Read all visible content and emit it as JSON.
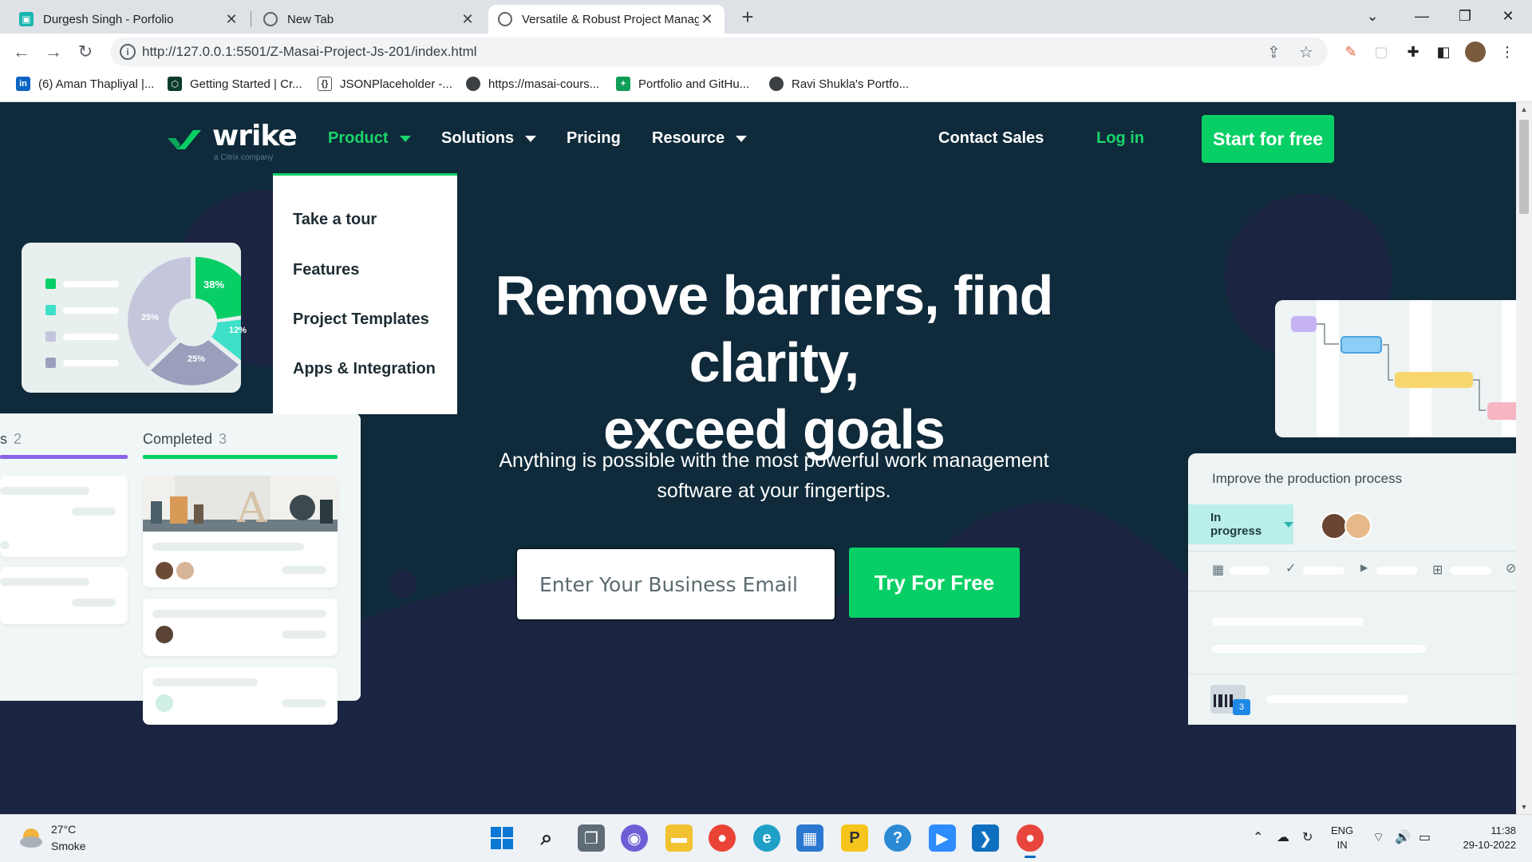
{
  "browser": {
    "tabs": [
      {
        "title": "Durgesh Singh - Porfolio",
        "icon": "portfolio-favicon"
      },
      {
        "title": "New Tab",
        "icon": "chrome-favicon"
      },
      {
        "title": "Versatile & Robust Project Manag",
        "icon": "globe-favicon"
      }
    ],
    "url": "http://127.0.0.1:5501/Z-Masai-Project-Js-201/index.html",
    "bookmarks": [
      {
        "label": "(6) Aman Thapliyal |...",
        "icon": "linkedin-icon"
      },
      {
        "label": "Getting Started | Cr...",
        "icon": "crypto-icon"
      },
      {
        "label": "JSONPlaceholder -...",
        "icon": "json-icon"
      },
      {
        "label": "https://masai-cours...",
        "icon": "globe-icon"
      },
      {
        "label": "Portfolio and GitHu...",
        "icon": "sheets-icon"
      },
      {
        "label": "Ravi Shukla's Portfo...",
        "icon": "globe-icon"
      }
    ]
  },
  "site": {
    "logo": {
      "word": "wrike",
      "sub": "a Citrix company"
    },
    "nav": {
      "product": "Product",
      "solutions": "Solutions",
      "pricing": "Pricing",
      "resource": "Resource",
      "contact": "Contact Sales",
      "login": "Log in",
      "start": "Start for free"
    },
    "dropdown": [
      "Take a tour",
      "Features",
      "Project Templates",
      "Apps & Integration"
    ],
    "hero": {
      "title_line1": "Remove barriers, find clarity,",
      "title_line2": "exceed goals",
      "subtitle_line1": "Anything is possible with the most powerful work management",
      "subtitle_line2": "software at your fingertips.",
      "email_placeholder": "Enter Your Business Email",
      "cta": "Try For Free"
    },
    "donut": {
      "labels": [
        "38%",
        "12%",
        "25%",
        "25%"
      ]
    },
    "kanban": {
      "col1_title": "s",
      "col1_count": "2",
      "col2_title": "Completed",
      "col2_count": "3"
    },
    "task": {
      "title": "Improve the production process",
      "status": "In progress",
      "badge": "3"
    },
    "colors": {
      "accent": "#08cf65",
      "bg": "#0f2a3a",
      "wave": "#1b2440"
    }
  },
  "taskbar": {
    "temp": "27°C",
    "weather": "Smoke",
    "lang_line1": "ENG",
    "lang_line2": "IN",
    "time": "11:38",
    "date": "29-10-2022"
  }
}
